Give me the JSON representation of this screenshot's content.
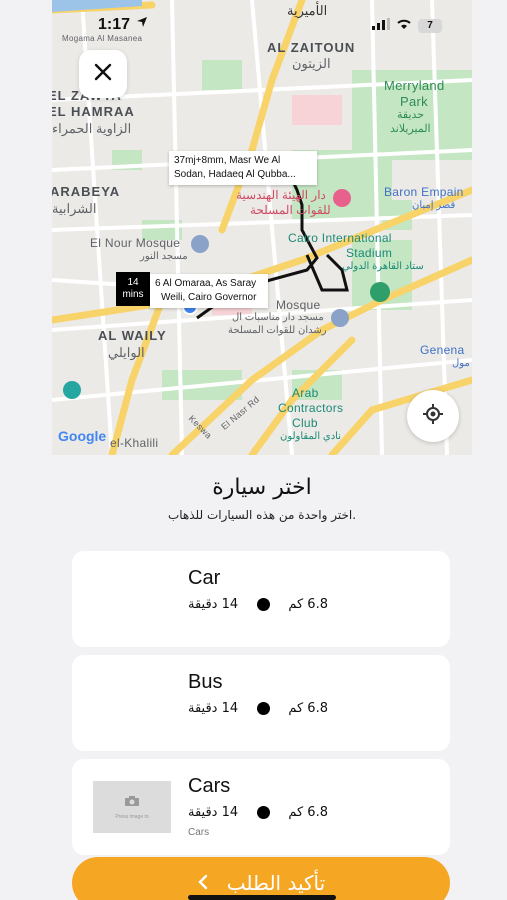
{
  "status_bar": {
    "time": "1:17",
    "battery": "7"
  },
  "map": {
    "labels": {
      "omiria": "الأميرية",
      "zaitoun_en": "AL ZAITOUN",
      "zaitoun_ar": "الزيتون",
      "merryland_en": "Merryland",
      "park_en": "Park",
      "merryland_ar": "حديقة",
      "merryland_ar2": "الميريلاند",
      "zawya_en": "EL ZAWYA",
      "hamraa_en": "EL HAMRAA",
      "zawya_ar": "الزاوية الحمراء",
      "sharabeya_en": "ARABEYA",
      "sharabeya_ar": "الشرابية",
      "baron_en": "Baron Empain",
      "baron_ar": "قصر إمبان",
      "engineering_ar1": "دار الهيئة الهندسية",
      "engineering_ar2": "للقوات المسلحة",
      "cairo_stadium_en1": "Cairo International",
      "cairo_stadium_en2": "Stadium",
      "cairo_stadium_ar": "ستاد القاهرة الدولي",
      "nour_mosque_en": "El Nour Mosque",
      "nour_mosque_ar": "مسجد النور",
      "rashdan_mosque_en": "Mosque",
      "rashdan_ar1": "مسجد دار مناسبات ال",
      "rashdan_ar2": "رشدان للقوات المسلحة",
      "waily_en": "AL WAILY",
      "waily_ar": "الوايلي",
      "genena_en": "Genena",
      "genena_ar": "مول",
      "arab_contractors_en1": "Arab",
      "arab_contractors_en2": "Contractors",
      "arab_contractors_en3": "Club",
      "arab_contractors_ar": "نادي المقاولون",
      "elnasr_rd": "El Nasr Rd",
      "keswa": "Keswa",
      "khalili": "el-Khalili",
      "mogamma": "Mogama Al Masanea",
      "google": "Google"
    },
    "destination_bubble": {
      "line1": "37mj+8mm, Masr We Al",
      "line2": "Sodan, Hadaeq Al Qubba..."
    },
    "origin_bubble": {
      "line1": "6 Al Omaraa, As Saray",
      "line2": "Weili, Cairo Governor"
    },
    "eta": {
      "value": "14",
      "unit": "mins"
    },
    "icons": {
      "close": "close-icon",
      "locate": "crosshair-icon"
    }
  },
  "sheet": {
    "title": "اختر سيارة",
    "subtitle": "اختر واحدة من هذه السيارات للذهاب.",
    "vehicles": [
      {
        "name": "Car",
        "distance": "6.8 كم",
        "duration": "14 دقيقة",
        "subtitle": ""
      },
      {
        "name": "Bus",
        "distance": "6.8 كم",
        "duration": "14 دقيقة",
        "subtitle": ""
      },
      {
        "name": "Cars",
        "distance": "6.8 كم",
        "duration": "14 دقيقة",
        "subtitle": "Cars"
      }
    ],
    "thumb_text": "Press image to",
    "confirm_label": "تأكيد الطلب"
  },
  "colors": {
    "accent": "#f5a623",
    "map_bg": "#eceae6",
    "road": "#f7d36a",
    "park": "#bfe3c0",
    "route": "#111111"
  }
}
